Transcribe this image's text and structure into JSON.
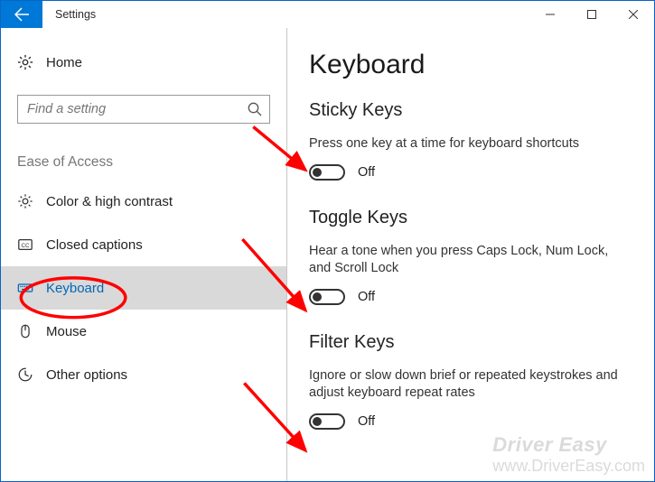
{
  "titlebar": {
    "title": "Settings"
  },
  "sidebar": {
    "home": "Home",
    "search_placeholder": "Find a setting",
    "category": "Ease of Access",
    "items": [
      {
        "label": "Color & high contrast"
      },
      {
        "label": "Closed captions"
      },
      {
        "label": "Keyboard"
      },
      {
        "label": "Mouse"
      },
      {
        "label": "Other options"
      }
    ]
  },
  "content": {
    "heading": "Keyboard",
    "sticky": {
      "title": "Sticky Keys",
      "desc": "Press one key at a time for keyboard shortcuts",
      "state": "Off"
    },
    "toggle": {
      "title": "Toggle Keys",
      "desc": "Hear a tone when you press Caps Lock, Num Lock, and Scroll Lock",
      "state": "Off"
    },
    "filter": {
      "title": "Filter Keys",
      "desc": "Ignore or slow down brief or repeated keystrokes and adjust keyboard repeat rates",
      "state": "Off"
    }
  },
  "watermark": {
    "brand": "Driver Easy",
    "url": "www.DriverEasy.com"
  }
}
